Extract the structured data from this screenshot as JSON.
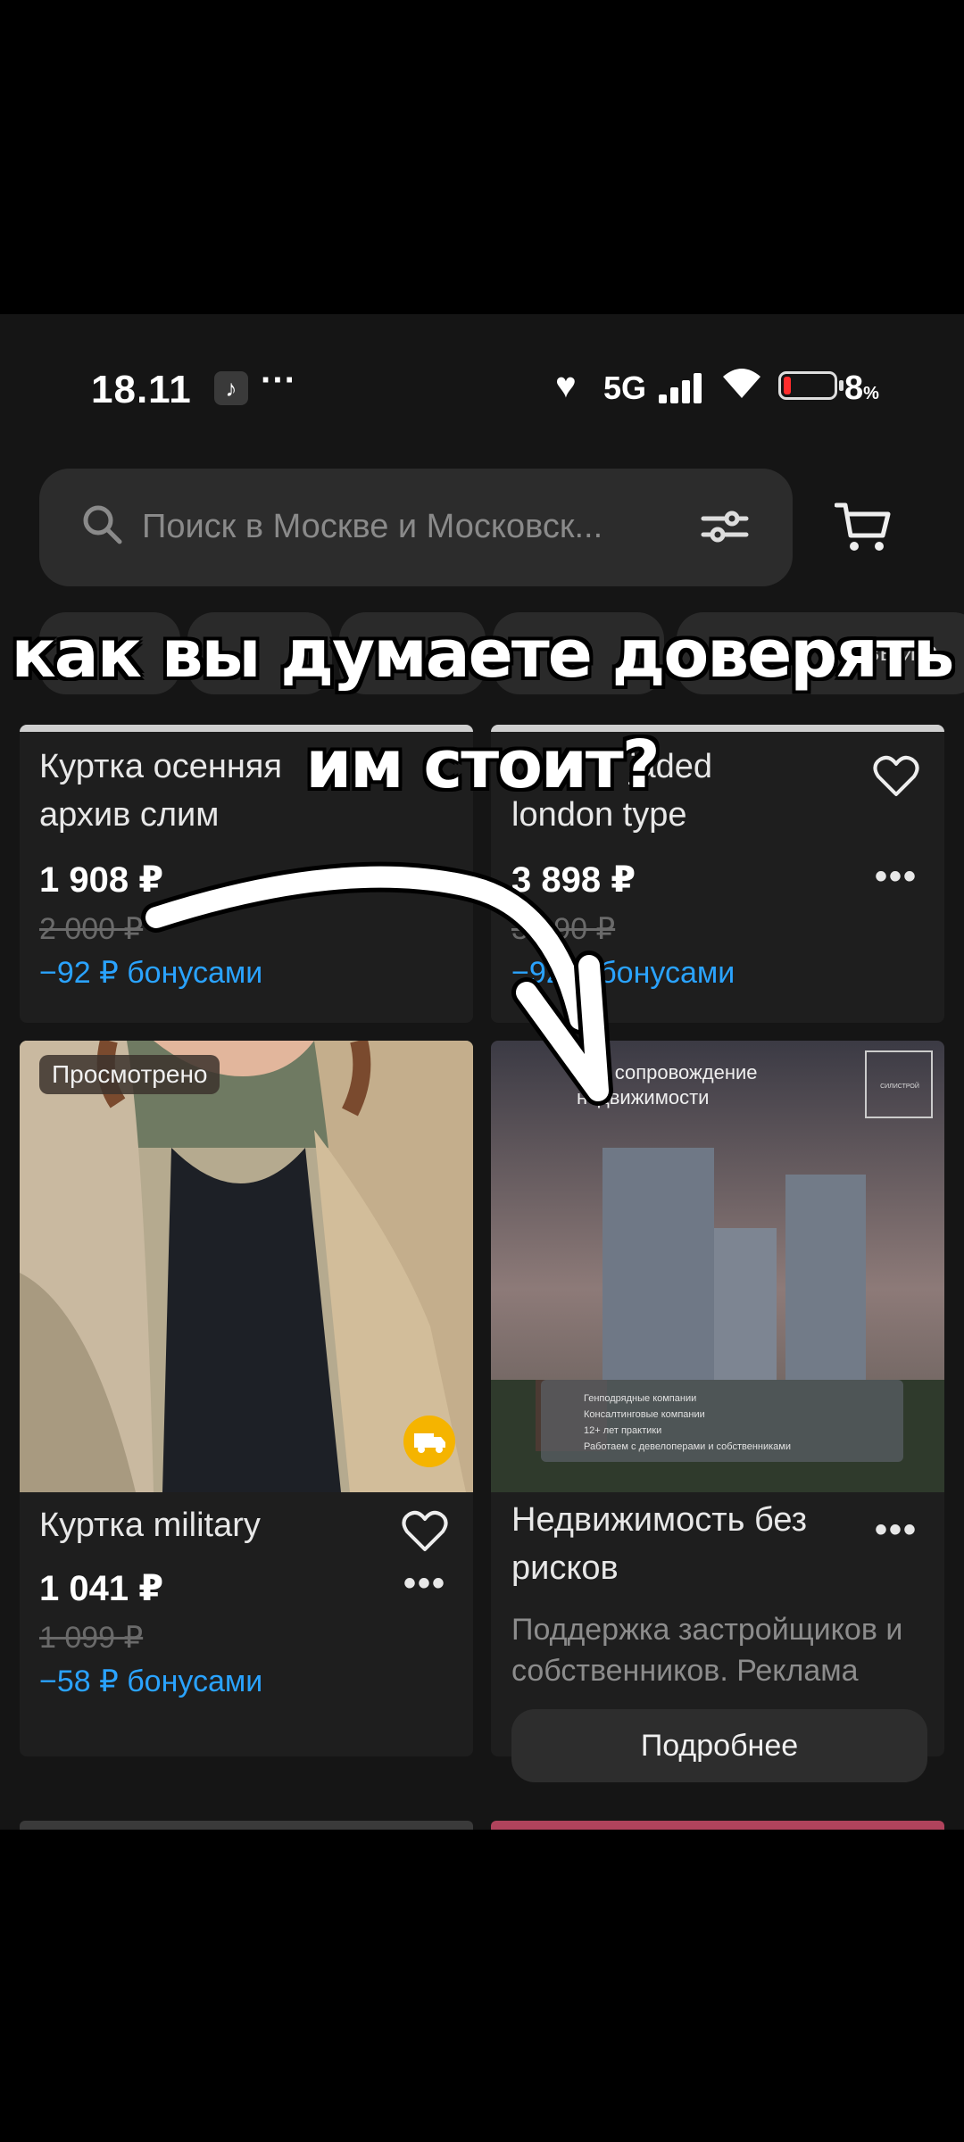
{
  "status_bar": {
    "time": "18.11",
    "app_icon": "tiktok-icon",
    "more": "···",
    "heart": "♥",
    "network": "5G",
    "battery_percent": "8",
    "battery_unit": "%"
  },
  "search": {
    "placeholder": "Поиск в Москве и Московск..."
  },
  "chips": [
    "",
    "",
    "",
    "",
    "бувь и а"
  ],
  "caption": {
    "line1": "как вы думаете доверять",
    "line2": "им стоит?"
  },
  "products": [
    {
      "title_line1": "Куртка осенняя",
      "title_line2": "архив слим",
      "price": "1 908 ₽",
      "old_price": "2 000 ₽",
      "bonus": "−92 ₽ бонусами"
    },
    {
      "title_line1": "jaded",
      "title_line2": "london type",
      "price": "3 898 ₽",
      "old_price": "3 990 ₽",
      "bonus": "−92 ₽ бонусами"
    },
    {
      "badge": "Просмотрено",
      "title": "Куртка military",
      "price": "1 041 ₽",
      "old_price": "1 099 ₽",
      "bonus": "−58 ₽ бонусами"
    }
  ],
  "ad": {
    "banner_line1": "ное сопровождение",
    "banner_line2": "недвижимости",
    "logo": "СИЛИСТРОЙ",
    "bullets": [
      "Генподрядные компании",
      "Консалтинговые компании",
      "12+ лет практики",
      "Работаем с девелоперами и собственниками"
    ],
    "title_line1": "Недвижимость без",
    "title_line2": "рисков",
    "description": "Поддержка застройщиков и собственников. Реклама",
    "button": "Подробнее"
  },
  "more_glyph": "•••",
  "colors": {
    "bonus": "#2aa3ff",
    "background": "#151515",
    "card": "#1e1e1e",
    "truck_badge": "#f5b400"
  }
}
